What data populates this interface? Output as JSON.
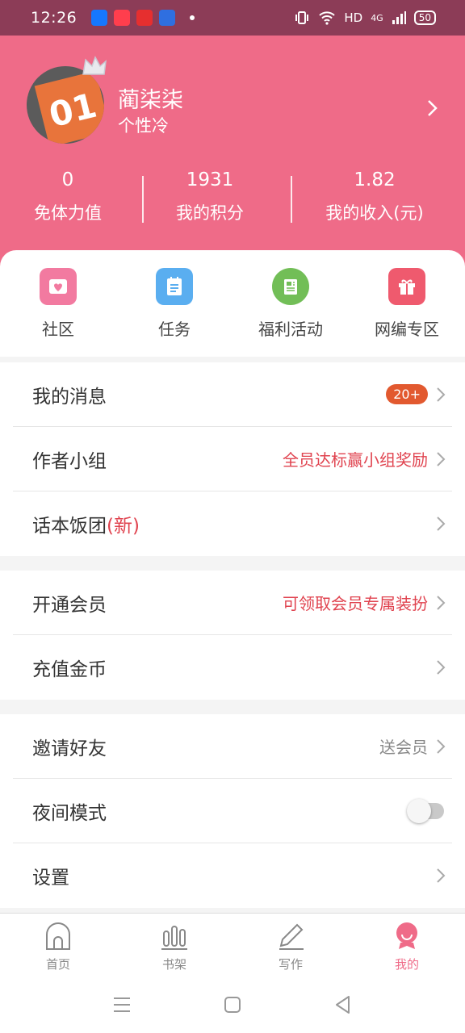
{
  "status_bar": {
    "time": "12:26",
    "network": "HD",
    "signal": "4G",
    "battery": "50",
    "icons": [
      "alipay-app-icon",
      "video-app-icon",
      "shopping-app-icon",
      "browser-app-icon",
      "vibrate-icon",
      "wifi-icon",
      "signal-icon"
    ]
  },
  "profile": {
    "username": "蔺柒柒",
    "signature": "个性冷",
    "avatar_text": "01"
  },
  "stats": [
    {
      "value": "0",
      "label": "免体力值"
    },
    {
      "value": "1931",
      "label": "我的积分"
    },
    {
      "value": "1.82",
      "label": "我的收入(元)"
    }
  ],
  "quick_actions": [
    {
      "label": "社区",
      "icon": "community-icon",
      "color": "#f27aa0"
    },
    {
      "label": "任务",
      "icon": "task-icon",
      "color": "#5aaef0"
    },
    {
      "label": "福利活动",
      "icon": "news-icon",
      "color": "#72be57"
    },
    {
      "label": "网编专区",
      "icon": "gift-icon",
      "color": "#ef5a6e"
    }
  ],
  "sections": {
    "messages": {
      "label": "我的消息",
      "badge": "20+"
    },
    "author_group": {
      "label": "作者小组",
      "promo": "全员达标赢小组奖励"
    },
    "script_group": {
      "label": "话本饭团",
      "tag": "(新)"
    },
    "membership": {
      "label": "开通会员",
      "promo": "可领取会员专属装扮"
    },
    "recharge": {
      "label": "充值金币"
    },
    "invite": {
      "label": "邀请好友",
      "hint": "送会员"
    },
    "night_mode": {
      "label": "夜间模式",
      "enabled": false
    },
    "settings": {
      "label": "设置"
    }
  },
  "bottom_nav": [
    {
      "label": "首页",
      "icon": "home-icon",
      "active": false
    },
    {
      "label": "书架",
      "icon": "bookshelf-icon",
      "active": false
    },
    {
      "label": "写作",
      "icon": "pen-icon",
      "active": false
    },
    {
      "label": "我的",
      "icon": "profile-icon",
      "active": true
    }
  ],
  "colors": {
    "brand_pink": "#ef6b88",
    "status_bar": "#8c3c57",
    "promo_red": "#e0434f",
    "badge_orange": "#e2592f"
  }
}
